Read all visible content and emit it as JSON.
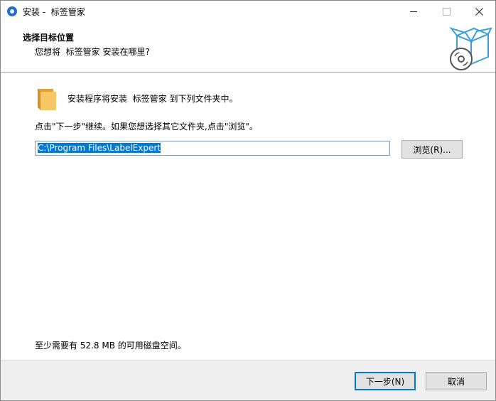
{
  "window": {
    "title": "安装 -  标签管家",
    "controls": {
      "minimize_icon": "minimize-icon",
      "maximize_icon": "maximize-icon",
      "close_icon": "close-icon"
    }
  },
  "header": {
    "title": "选择目标位置",
    "subtitle": "您想将  标签管家 安装在哪里?",
    "art_icon": "installer-box-disc-icon"
  },
  "body": {
    "folder_icon": "folder-icon",
    "install_message": "安装程序将安装  标签管家 到下列文件夹中。",
    "next_hint": "点击\"下一步\"继续。如果您想选择其它文件夹,点击\"浏览\"。",
    "path_value": "C:\\Program Files\\LabelExpert",
    "browse_label": "浏览(R)...",
    "space_message": "至少需要有 52.8 MB 的可用磁盘空间。"
  },
  "footer": {
    "next_label": "下一步(N)",
    "cancel_label": "取消"
  },
  "colors": {
    "accent": "#0078d7",
    "selection": "#0078d7",
    "footer_bg": "#f0f0f0",
    "folder": "#f2b54a"
  }
}
